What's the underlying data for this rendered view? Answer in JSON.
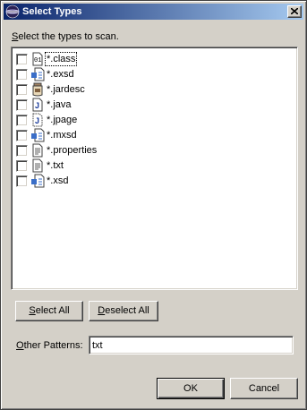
{
  "window": {
    "title": "Select Types",
    "app_icon": "eclipse-icon",
    "close_icon": "close-icon"
  },
  "instruction": {
    "mnemonic": "S",
    "rest": "elect the types to scan."
  },
  "types": [
    {
      "label": "*.class",
      "icon": "class-file-icon",
      "checked": false,
      "focused": true
    },
    {
      "label": "*.exsd",
      "icon": "schema-file-icon",
      "checked": false,
      "focused": false
    },
    {
      "label": "*.jardesc",
      "icon": "jar-descriptor-icon",
      "checked": false,
      "focused": false
    },
    {
      "label": "*.java",
      "icon": "java-file-icon",
      "checked": false,
      "focused": false
    },
    {
      "label": "*.jpage",
      "icon": "java-scrapbook-icon",
      "checked": false,
      "focused": false
    },
    {
      "label": "*.mxsd",
      "icon": "schema-file-icon",
      "checked": false,
      "focused": false
    },
    {
      "label": "*.properties",
      "icon": "text-file-icon",
      "checked": false,
      "focused": false
    },
    {
      "label": "*.txt",
      "icon": "text-file-icon",
      "checked": false,
      "focused": false
    },
    {
      "label": "*.xsd",
      "icon": "schema-file-icon",
      "checked": false,
      "focused": false
    }
  ],
  "buttons": {
    "select_all": {
      "mnemonic": "S",
      "rest": "elect All"
    },
    "deselect_all": {
      "mnemonic": "D",
      "rest": "eselect All"
    },
    "ok": "OK",
    "cancel": "Cancel"
  },
  "other_patterns": {
    "label_mnemonic": "O",
    "label_rest": "ther Patterns:",
    "value": "txt"
  },
  "colors": {
    "titlebar_start": "#0a246a",
    "titlebar_end": "#a6caf0",
    "dialog_bg": "#d4d0c8"
  }
}
